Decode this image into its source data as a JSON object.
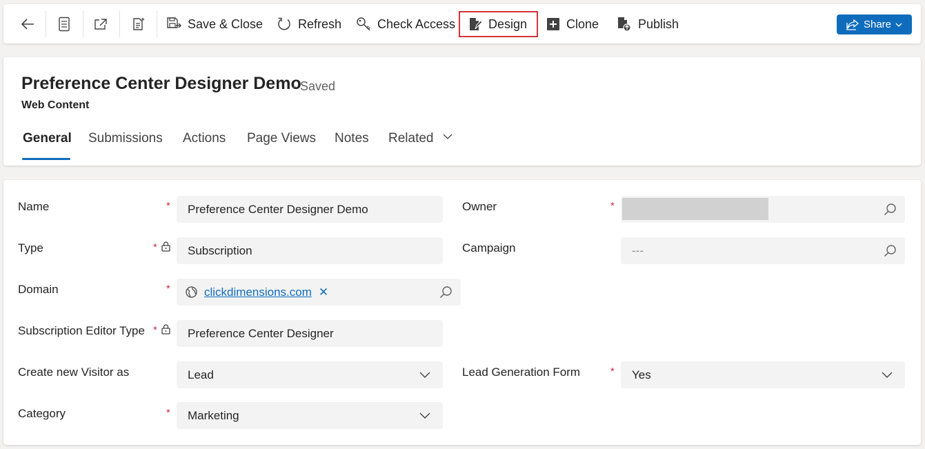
{
  "toolbar": {
    "save_close_label": "Save & Close",
    "refresh_label": "Refresh",
    "check_access_label": "Check Access",
    "design_label": "Design",
    "clone_label": "Clone",
    "publish_label": "Publish",
    "share_label": "Share",
    "highlight_color": "#d13438",
    "accent_color": "#0f6cbd"
  },
  "record": {
    "title": "Preference Center Designer Demo",
    "status": "- Saved",
    "entity": "Web Content"
  },
  "tabs": [
    {
      "label": "General",
      "active": true
    },
    {
      "label": "Submissions"
    },
    {
      "label": "Actions"
    },
    {
      "label": "Page Views"
    },
    {
      "label": "Notes"
    },
    {
      "label": "Related"
    }
  ],
  "form": {
    "name": {
      "label": "Name",
      "value": "Preference Center Designer Demo",
      "required": "*"
    },
    "type": {
      "label": "Type",
      "value": "Subscription",
      "required": "*"
    },
    "domain": {
      "label": "Domain",
      "value": "clickdimensions.com",
      "required": "*"
    },
    "editor_type": {
      "label": "Subscription Editor Type",
      "value": "Preference Center Designer",
      "required": "*"
    },
    "visitor": {
      "label": "Create new Visitor as",
      "value": "Lead"
    },
    "category": {
      "label": "Category",
      "value": "Marketing",
      "required": "*"
    },
    "owner": {
      "label": "Owner",
      "value": "",
      "required": "*"
    },
    "campaign": {
      "label": "Campaign",
      "value": "---"
    },
    "lead_gen": {
      "label": "Lead Generation Form",
      "value": "Yes",
      "required": "*"
    }
  }
}
